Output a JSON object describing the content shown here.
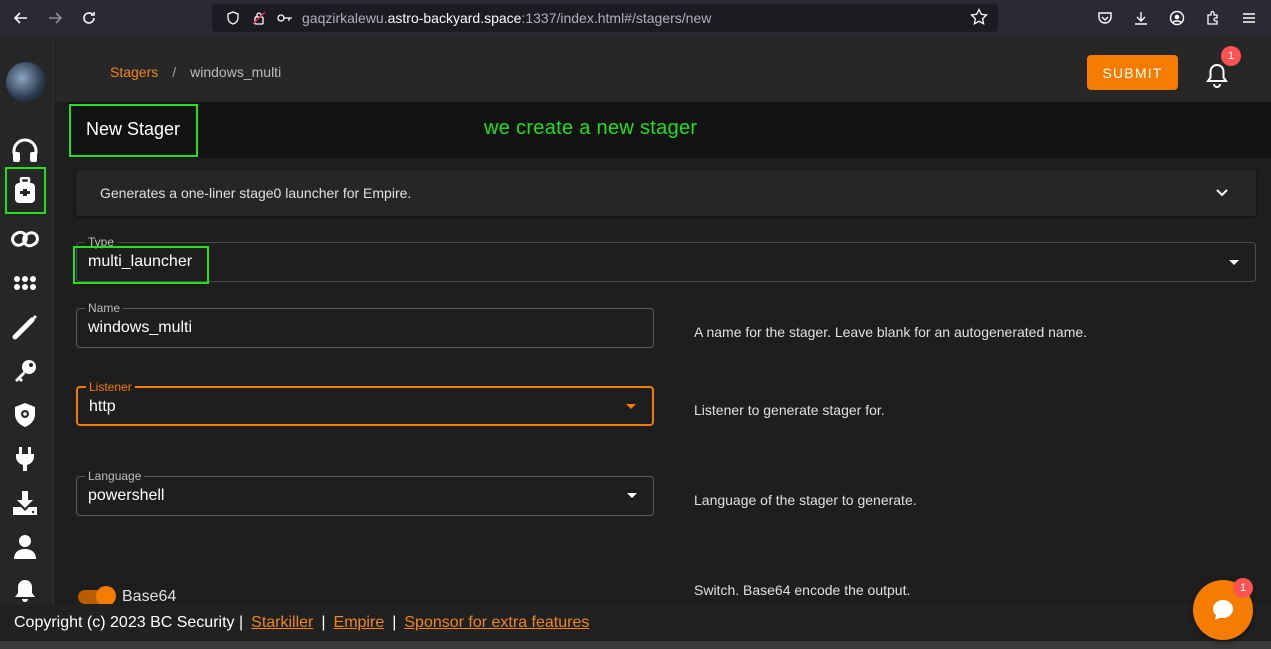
{
  "browser": {
    "url_prefix": "gaqzirkalewu.",
    "url_domain": "astro-backyard.space",
    "url_suffix": ":1337/index.html#/stagers/new"
  },
  "breadcrumb": {
    "parent": "Stagers",
    "separator": "/",
    "current": "windows_multi"
  },
  "header": {
    "submit_label": "SUBMIT",
    "notification_count": "1"
  },
  "page": {
    "title": "New Stager",
    "annotation": "we create a new stager"
  },
  "description": {
    "text": "Generates a one-liner stage0 launcher for Empire."
  },
  "form": {
    "type": {
      "label": "Type",
      "value": "multi_launcher"
    },
    "name": {
      "label": "Name",
      "value": "windows_multi",
      "help": "A name for the stager. Leave blank for an autogenerated name."
    },
    "listener": {
      "label": "Listener",
      "value": "http",
      "help": "Listener to generate stager for."
    },
    "language": {
      "label": "Language",
      "value": "powershell",
      "help": "Language of the stager to generate."
    },
    "base64": {
      "label": "Base64",
      "help": "Switch. Base64 encode the output.",
      "enabled": true
    }
  },
  "footer": {
    "copyright": "Copyright (c) 2023 BC Security |",
    "link_starkiller": "Starkiller",
    "link_empire": "Empire",
    "link_sponsor": "Sponsor for extra features",
    "pipe": "|"
  },
  "chat": {
    "badge_count": "1"
  },
  "colors": {
    "accent": "#f57c00",
    "highlight": "#22e01a",
    "badge": "#ff5252"
  },
  "sidebar": {
    "icons": [
      "headphones-icon",
      "briefcase-icon",
      "link-icon",
      "grid-icon",
      "wand-icon",
      "key-icon",
      "shield-icon",
      "plug-icon",
      "download-icon",
      "user-icon",
      "bell-icon"
    ]
  }
}
